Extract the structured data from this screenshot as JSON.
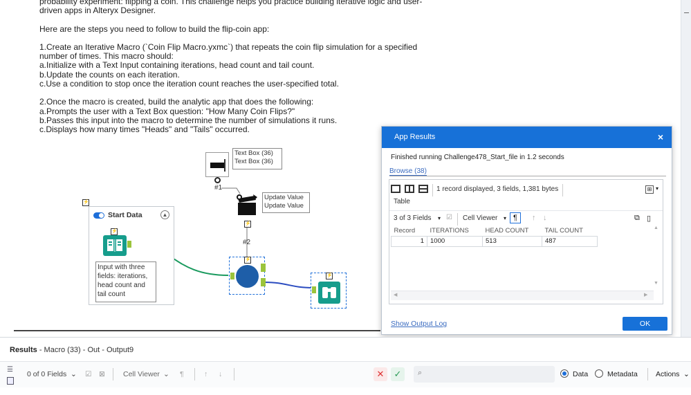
{
  "comment": {
    "lines": [
      "probability experiment: flipping a coin. This challenge helps you practice building iterative logic and user-",
      "driven apps in Alteryx Designer.",
      "",
      "Here are the steps you need to follow to build the flip-coin app:",
      "",
      "1.Create an Iterative Macro (`Coin Flip Macro.yxmc`) that repeats the coin flip simulation for a specified",
      "number of times. This macro should:",
      "a.Initialize with a Text Input containing iterations, head count and tail count.",
      "b.Update the counts on each iteration.",
      "c.Use a condition to stop once the iteration count reaches the user-specified total.",
      "",
      "2.Once the macro is created, build the analytic app that does the following:",
      "a.Prompts the user with a Text Box question: \"How Many Coin Flips?\"",
      "b.Passes this input into the macro to determine the number of simulations it runs.",
      "c.Displays how many times \"Heads\" and \"Tails\" occurred."
    ]
  },
  "workflow": {
    "textbox_label_1": "Text Box (36)",
    "textbox_label_2": "Text Box (36)",
    "textbox_id": "#1",
    "update_label_1": "Update Value",
    "update_label_2": "Update Value",
    "macro_id": "#2",
    "container_title": "Start Data",
    "input_annotation": "Input with three fields: iterations, head count and tail count",
    "lightning": "⚡"
  },
  "dialog": {
    "title": "App Results",
    "close": "×",
    "message": "Finished running Challenge478_Start_file in 1.2 seconds",
    "browse": "Browse (38)",
    "records_info": "1 record displayed, 3 fields, 1,381 bytes",
    "table_tab": "Table",
    "fields_selector": "3 of 3 Fields",
    "cell_viewer": "Cell Viewer",
    "columns": [
      "Record",
      "ITERATIONS",
      "HEAD COUNT",
      "TAIL COUNT"
    ],
    "rows": [
      [
        "1",
        "1000",
        "513",
        "487"
      ]
    ],
    "show_output_log": "Show Output Log",
    "ok": "OK"
  },
  "results": {
    "title_bold": "Results",
    "title_rest": "- Macro (33) - Out - Output9",
    "fields_selector": "0 of 0 Fields",
    "cell_viewer": "Cell Viewer",
    "data_label": "Data",
    "metadata_label": "Metadata",
    "actions_label": "Actions"
  },
  "colors": {
    "accent": "#1771d8",
    "connector_green": "#1a9a5e",
    "connector_blue": "#2b4cc0",
    "macro_blue": "#1e5ea8",
    "browse_teal": "#169d8c"
  }
}
